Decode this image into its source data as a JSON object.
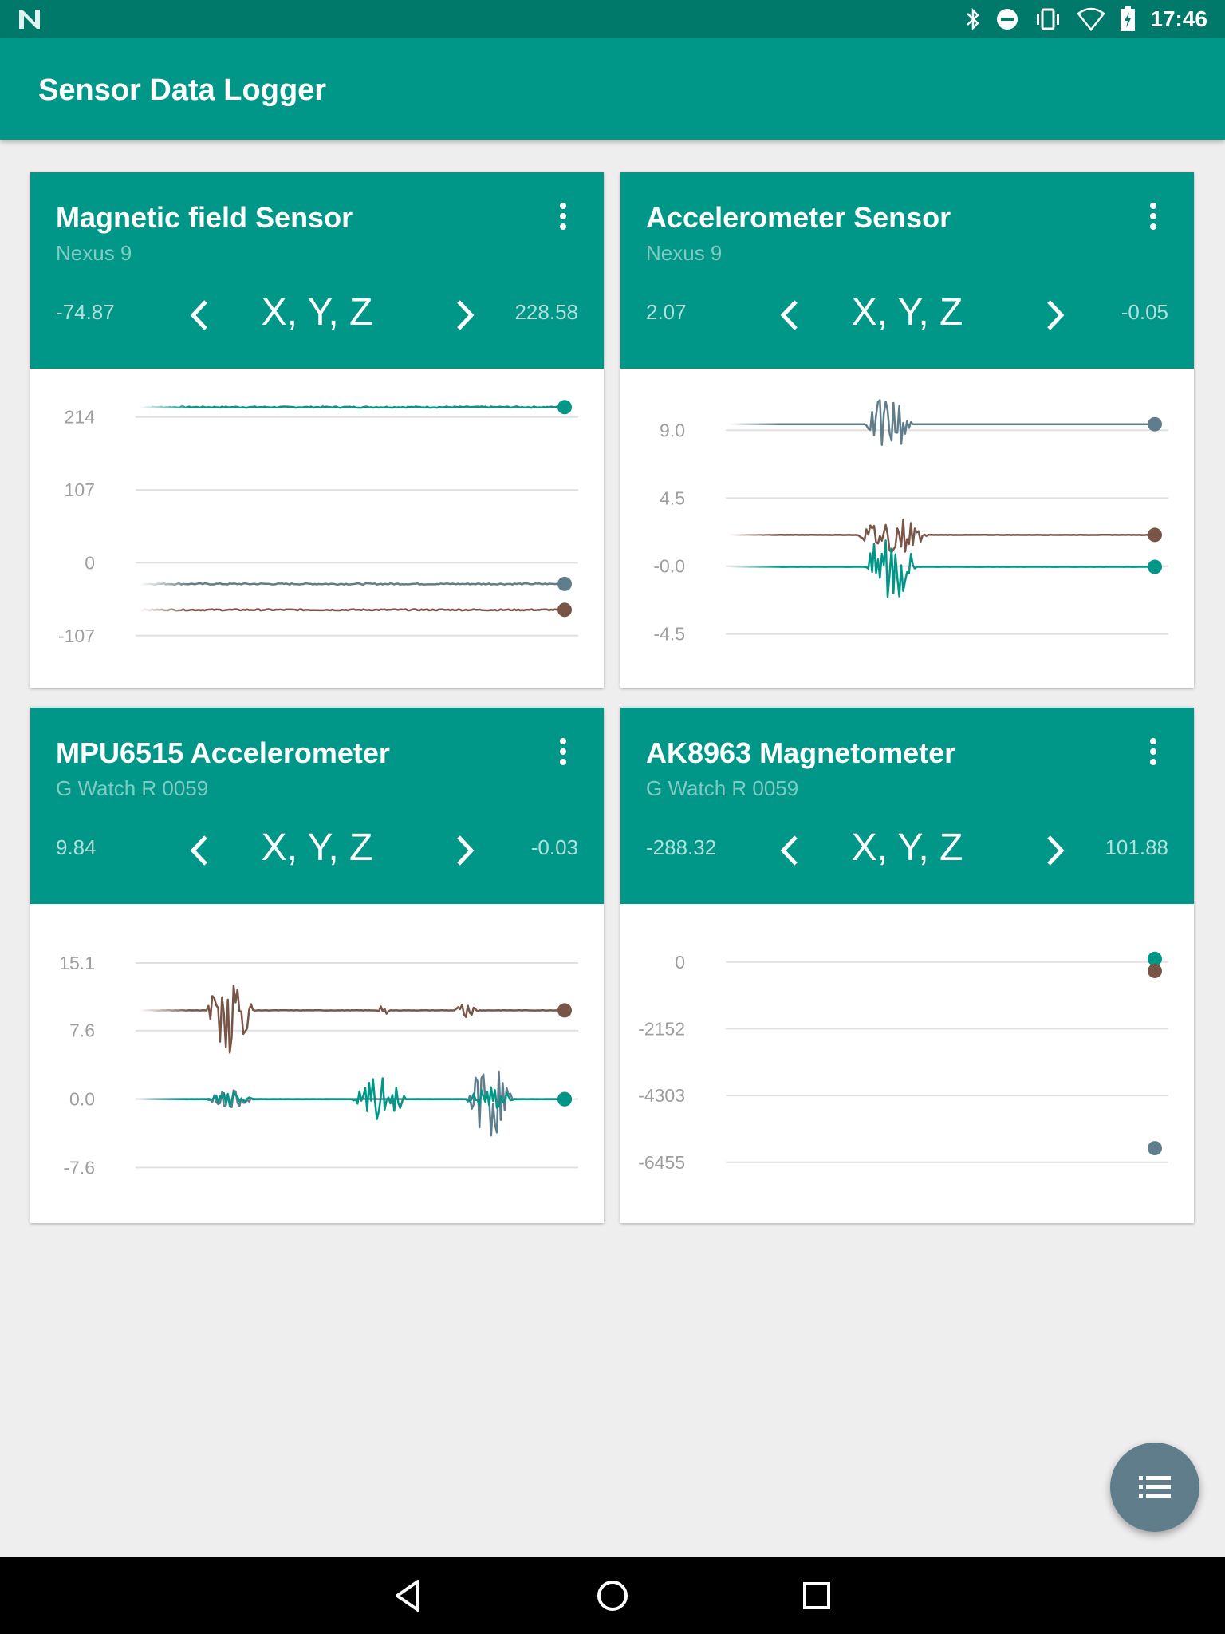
{
  "status_bar": {
    "time": "17:46",
    "icons": [
      "notification-n-icon",
      "bluetooth-icon",
      "do-not-disturb-icon",
      "vibrate-icon",
      "wifi-icon",
      "battery-charging-icon"
    ]
  },
  "app": {
    "title": "Sensor Data Logger"
  },
  "colors": {
    "primary": "#009688",
    "primary_dark": "#00796b",
    "series_x": "#009688",
    "series_y": "#795548",
    "series_z": "#607d8b",
    "fab": "#607d8b"
  },
  "cards": [
    {
      "title": "Magnetic field Sensor",
      "device": "Nexus 9",
      "min_value": "-74.87",
      "max_value": "228.58",
      "axes_label": "X, Y, Z",
      "chart_data": {
        "type": "line",
        "y_ticks": [
          "214",
          "107",
          "0",
          "-107"
        ],
        "ylim": [
          -160,
          250
        ],
        "grid": true,
        "series": [
          {
            "color": "#009688",
            "base": 228.6,
            "noise": 0.6,
            "bursts": []
          },
          {
            "color": "#607d8b",
            "base": -31,
            "noise": 0.6,
            "bursts": []
          },
          {
            "color": "#795548",
            "base": -69,
            "noise": 0.6,
            "bursts": []
          }
        ]
      }
    },
    {
      "title": "Accelerometer Sensor",
      "device": "Nexus 9",
      "min_value": "2.07",
      "max_value": "-0.05",
      "axes_label": "X, Y, Z",
      "chart_data": {
        "type": "line",
        "y_ticks": [
          "9.0",
          "4.5",
          "-0.0",
          "-4.5"
        ],
        "ylim": [
          -7,
          11.5
        ],
        "grid": true,
        "series": [
          {
            "color": "#607d8b",
            "base": 9.4,
            "noise": 0.05,
            "bursts": [
              [
                0.32,
                0.43,
                2.0
              ]
            ]
          },
          {
            "color": "#795548",
            "base": 2.07,
            "noise": 0.12,
            "bursts": [
              [
                0.3,
                0.47,
                1.3
              ]
            ]
          },
          {
            "color": "#009688",
            "base": -0.05,
            "noise": 0.05,
            "bursts": [
              [
                0.32,
                0.44,
                3.0
              ]
            ]
          }
        ]
      }
    },
    {
      "title": "MPU6515 Accelerometer",
      "device": "G Watch R 0059",
      "min_value": "9.84",
      "max_value": "-0.03",
      "axes_label": "X, Y, Z",
      "chart_data": {
        "type": "line",
        "y_ticks": [
          "15.1",
          "7.6",
          "0.0",
          "-7.6"
        ],
        "ylim": [
          -12,
          19
        ],
        "grid": true,
        "series": [
          {
            "color": "#795548",
            "base": 9.84,
            "noise": 0.15,
            "bursts": [
              [
                0.16,
                0.27,
                5.0
              ],
              [
                0.56,
                0.59,
                0.6
              ],
              [
                0.74,
                0.8,
                0.8
              ]
            ]
          },
          {
            "color": "#607d8b",
            "base": 0.0,
            "noise": 0.05,
            "bursts": [
              [
                0.16,
                0.27,
                1.0
              ],
              [
                0.77,
                0.88,
                4.5
              ]
            ]
          },
          {
            "color": "#009688",
            "base": -0.03,
            "noise": 0.05,
            "bursts": [
              [
                0.16,
                0.27,
                0.8
              ],
              [
                0.5,
                0.63,
                2.5
              ],
              [
                0.77,
                0.88,
                1.5
              ]
            ]
          }
        ]
      }
    },
    {
      "title": "AK8963 Magnetometer",
      "device": "G Watch R 0059",
      "min_value": "-288.32",
      "max_value": "101.88",
      "axes_label": "X, Y, Z",
      "chart_data": {
        "type": "line",
        "y_ticks": [
          "0",
          "-2152",
          "-4303",
          "-6455"
        ],
        "ylim": [
          -7900,
          1100
        ],
        "grid": true,
        "series": [
          {
            "color": "#009688",
            "base": 101.88,
            "noise": 0,
            "bursts": []
          },
          {
            "color": "#795548",
            "base": -288.32,
            "noise": 0,
            "bursts": []
          },
          {
            "color": "#607d8b",
            "base": -6000,
            "noise": 0,
            "bursts": []
          }
        ]
      }
    }
  ],
  "fab": {
    "icon": "list-icon"
  },
  "nav_bar": {
    "icons": [
      "back-icon",
      "home-icon",
      "recents-icon"
    ]
  }
}
